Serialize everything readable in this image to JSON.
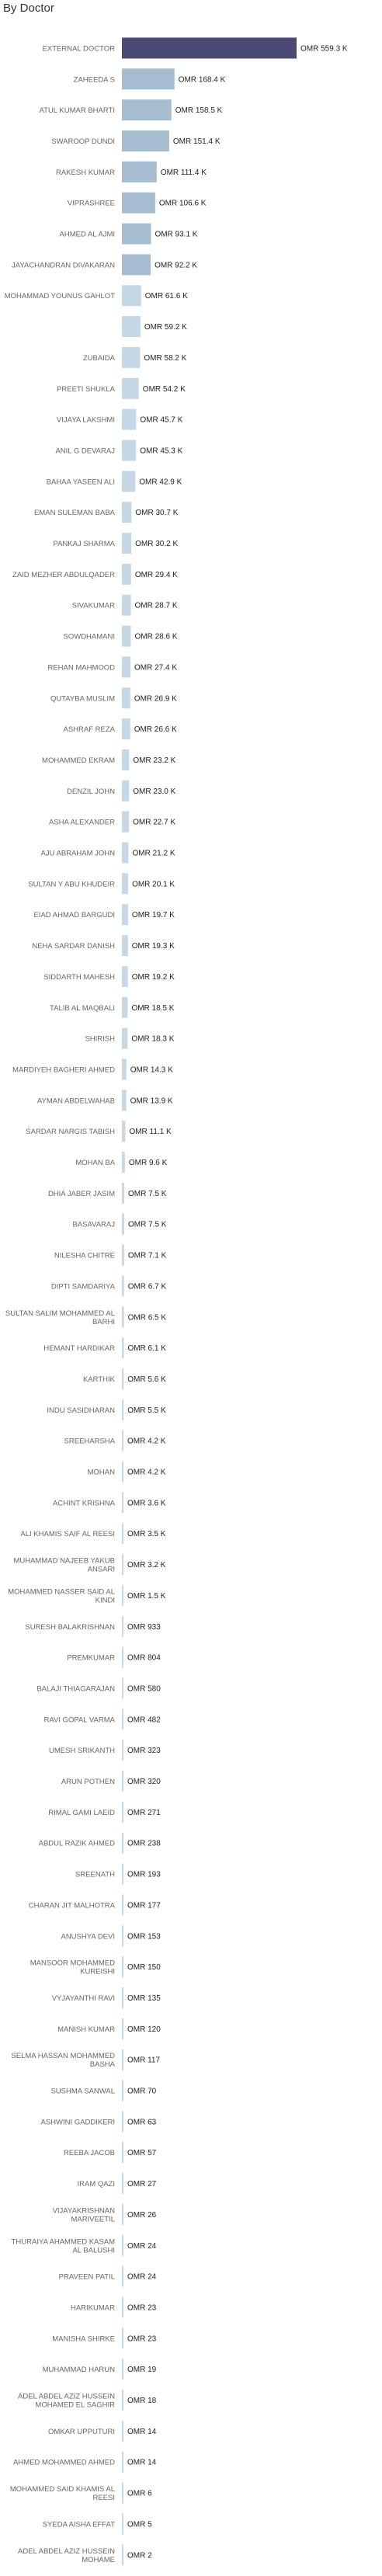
{
  "chart_data": {
    "type": "bar",
    "orientation": "horizontal",
    "title": "By Doctor",
    "value_prefix": "OMR ",
    "colors": {
      "top_bar": "#4a4a72",
      "mid_bar": "#a6bccf",
      "low_bar": "#c6d8e6"
    },
    "categories": [
      "EXTERNAL DOCTOR",
      "ZAHEEDA S",
      "ATUL KUMAR BHARTI",
      "SWAROOP DUNDI",
      "RAKESH KUMAR",
      "VIPRASHREE",
      "AHMED AL AJMI",
      "JAYACHANDRAN DIVAKARAN",
      "MOHAMMAD YOUNUS GAHLOT",
      "",
      "ZUBAIDA",
      "PREETI SHUKLA",
      "VIJAYA LAKSHMI",
      "ANIL G DEVARAJ",
      "BAHAA YASEEN ALI",
      "EMAN SULEMAN BABA",
      "PANKAJ SHARMA",
      "ZAID MEZHER ABDULQADER",
      "SIVAKUMAR",
      "SOWDHAMANI",
      "REHAN MAHMOOD",
      "QUTAYBA MUSLIM",
      "ASHRAF REZA",
      "MOHAMMED EKRAM",
      "DENZIL JOHN",
      "ASHA ALEXANDER",
      "AJU ABRAHAM JOHN",
      "SULTAN Y ABU KHUDEIR",
      "EIAD AHMAD BARGUDI",
      "NEHA SARDAR DANISH",
      "SIDDARTH MAHESH",
      "TALIB AL MAQBALI",
      "SHIRISH",
      "MARDIYEH BAGHERI AHMED",
      "AYMAN ABDELWAHAB",
      "SARDAR NARGIS TABISH",
      "MOHAN BA",
      "DHIA JABER JASIM",
      "BASAVARAJ",
      "NILESHA CHITRE",
      "DIPTI SAMDARIYA",
      "SULTAN SALIM MOHAMMED AL BARHI",
      "HEMANT HARDIKAR",
      "KARTHIK",
      "INDU SASIDHARAN",
      "SREEHARSHA",
      "MOHAN",
      "ACHINT KRISHNA",
      "ALI KHAMIS SAIF AL REESI",
      "MUHAMMAD NAJEEB YAKUB ANSARI",
      "MOHAMMED NASSER SAID AL KINDI",
      "SURESH BALAKRISHNAN",
      "PREMKUMAR",
      "BALAJI THIAGARAJAN",
      "RAVI GOPAL VARMA",
      "UMESH SRIKANTH",
      "ARUN POTHEN",
      "RIMAL GAMI LAEID",
      "ABDUL RAZIK AHMED",
      "SREENATH",
      "CHARAN JIT MALHOTRA",
      "ANUSHYA DEVI",
      "MANSOOR MOHAMMED KUREISHI",
      "VYJAYANTHI RAVI",
      "MANISH KUMAR",
      "SELMA HASSAN MOHAMMED BASHA",
      "SUSHMA SANWAL",
      "ASHWINI GADDIKERI",
      "REEBA JACOB",
      "IRAM QAZI",
      "VIJAYAKRISHNAN MARIVEETIL",
      "THURAIYA AHAMMED KASAM AL BALUSHI",
      "PRAVEEN PATIL",
      "HARIKUMAR",
      "MANISHA SHIRKE",
      "MUHAMMAD HARUN",
      "ADEL ABDEL AZIZ HUSSEIN MOHAMED EL SAGHIR",
      "OMKAR UPPUTURI",
      "AHMED MOHAMMED AHMED",
      "MOHAMMED SAID KHAMIS AL REESI",
      "SYEDA AISHA EFFAT",
      "ADEL ABDEL AZIZ HUSSEIN MOHAME"
    ],
    "values": [
      559300,
      168400,
      158500,
      151400,
      111400,
      106600,
      93100,
      92200,
      61600,
      59200,
      58200,
      54200,
      45700,
      45300,
      42900,
      30700,
      30200,
      29400,
      28700,
      28600,
      27400,
      26900,
      26600,
      23200,
      23000,
      22700,
      21200,
      20100,
      19700,
      19300,
      19200,
      18500,
      18300,
      14300,
      13900,
      11100,
      9600,
      7500,
      7500,
      7100,
      6700,
      6500,
      6100,
      5600,
      5500,
      4200,
      4200,
      3600,
      3500,
      3200,
      1500,
      933,
      804,
      580,
      482,
      323,
      320,
      271,
      238,
      193,
      177,
      153,
      150,
      135,
      120,
      117,
      70,
      63,
      57,
      27,
      26,
      24,
      24,
      23,
      23,
      19,
      18,
      14,
      14,
      6,
      5,
      2
    ],
    "value_labels": [
      "OMR 559.3 K",
      "OMR 168.4 K",
      "OMR 158.5 K",
      "OMR 151.4 K",
      "OMR 111.4 K",
      "OMR 106.6 K",
      "OMR 93.1 K",
      "OMR 92.2 K",
      "OMR 61.6 K",
      "OMR 59.2 K",
      "OMR 58.2 K",
      "OMR 54.2 K",
      "OMR 45.7 K",
      "OMR 45.3 K",
      "OMR 42.9 K",
      "OMR 30.7 K",
      "OMR 30.2 K",
      "OMR 29.4 K",
      "OMR 28.7 K",
      "OMR 28.6 K",
      "OMR 27.4 K",
      "OMR 26.9 K",
      "OMR 26.6 K",
      "OMR 23.2 K",
      "OMR 23.0 K",
      "OMR 22.7 K",
      "OMR 21.2 K",
      "OMR 20.1 K",
      "OMR 19.7 K",
      "OMR 19.3 K",
      "OMR 19.2 K",
      "OMR 18.5 K",
      "OMR 18.3 K",
      "OMR 14.3 K",
      "OMR 13.9 K",
      "OMR 11.1 K",
      "OMR 9.6 K",
      "OMR 7.5 K",
      "OMR 7.5 K",
      "OMR 7.1 K",
      "OMR 6.7 K",
      "OMR 6.5 K",
      "OMR 6.1 K",
      "OMR 5.6 K",
      "OMR 5.5 K",
      "OMR 4.2 K",
      "OMR 4.2 K",
      "OMR 3.6 K",
      "OMR 3.5 K",
      "OMR 3.2 K",
      "OMR 1.5 K",
      "OMR 933",
      "OMR 804",
      "OMR 580",
      "OMR 482",
      "OMR 323",
      "OMR 320",
      "OMR 271",
      "OMR 238",
      "OMR 193",
      "OMR 177",
      "OMR 153",
      "OMR 150",
      "OMR 135",
      "OMR 120",
      "OMR 117",
      "OMR 70",
      "OMR 63",
      "OMR 57",
      "OMR 27",
      "OMR 26",
      "OMR 24",
      "OMR 24",
      "OMR 23",
      "OMR 23",
      "OMR 19",
      "OMR 18",
      "OMR 14",
      "OMR 14",
      "OMR 6",
      "OMR 5",
      "OMR 2"
    ],
    "xlabel": "",
    "ylabel": "",
    "grid": false,
    "legend": "none"
  }
}
